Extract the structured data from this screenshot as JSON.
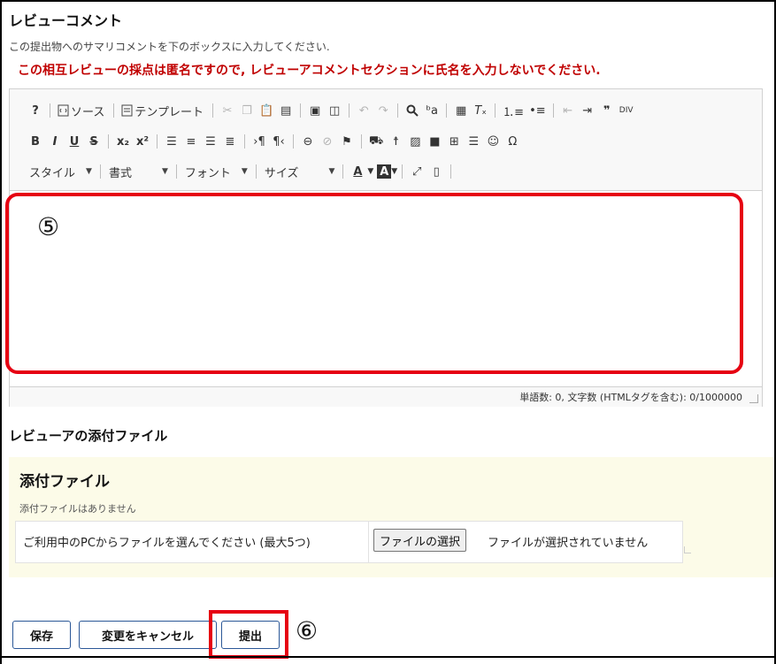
{
  "page": {
    "title": "レビューコメント",
    "description": "この提出物へのサマリコメントを下のボックスに入力してください.",
    "warning": "この相互レビューの採点は匿名ですので, レビューアコメントセクションに氏名を入力しないでください."
  },
  "editor": {
    "toolbar_row1": {
      "help": "?",
      "source": "ソース",
      "template": "テンプレート"
    },
    "toolbar_row2": {
      "bold": "B",
      "italic": "I",
      "underline": "U",
      "strike": "S",
      "subscript": "x₂",
      "superscript": "x²",
      "omega": "Ω"
    },
    "toolbar_row3": {
      "style": "スタイル",
      "format": "書式",
      "font": "フォント",
      "size": "サイズ",
      "text_color": "A",
      "bg_color": "A"
    },
    "content": "",
    "status": "単語数: 0, 文字数 (HTMLタグを含む): 0/1000000"
  },
  "markers": {
    "editor_marker": "⑤",
    "submit_marker": "⑥"
  },
  "attachments": {
    "section_title": "レビューアの添付ファイル",
    "heading": "添付ファイル",
    "none_text": "添付ファイルはありません",
    "upload_label": "ご利用中のPCからファイルを選んでください (最大5つ)",
    "file_button": "ファイルの選択",
    "file_status": "ファイルが選択されていません"
  },
  "buttons": {
    "save": "保存",
    "cancel": "変更をキャンセル",
    "submit": "提出"
  },
  "colors": {
    "warning": "#c00000",
    "highlight": "#e60012",
    "button_border": "#2b5797",
    "attach_bg": "#fcfbe8"
  }
}
